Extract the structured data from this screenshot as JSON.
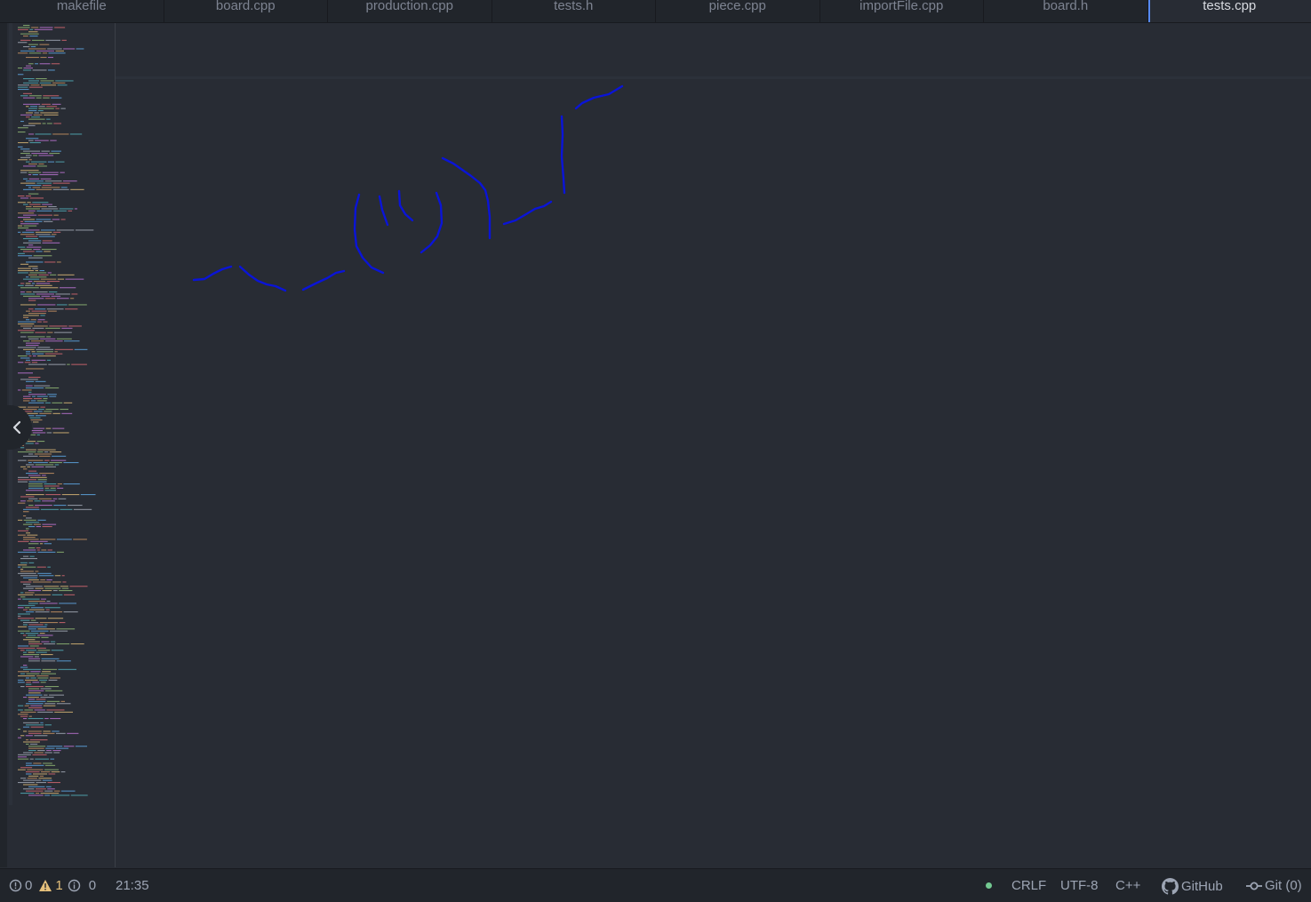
{
  "tabs": [
    {
      "label": "makefile",
      "active": false
    },
    {
      "label": "board.cpp",
      "active": false
    },
    {
      "label": "production.cpp",
      "active": false
    },
    {
      "label": "tests.h",
      "active": false
    },
    {
      "label": "piece.cpp",
      "active": false
    },
    {
      "label": "importFile.cpp",
      "active": false
    },
    {
      "label": "board.h",
      "active": false
    },
    {
      "label": "tests.cpp",
      "active": true
    }
  ],
  "editor": {
    "minimap_icon": "minimap-code-preview",
    "collapse_icon": "chevron-left-icon",
    "annotation_color": "#0a14d8"
  },
  "status": {
    "errors": "0",
    "warnings": "1",
    "infos": "0",
    "cursor_position": "21:35",
    "line_ending": "CRLF",
    "encoding": "UTF-8",
    "grammar": "C++",
    "github": "GitHub",
    "git": "Git (0)",
    "warning_color": "#e5c07b",
    "dot_color": "#73c991"
  }
}
